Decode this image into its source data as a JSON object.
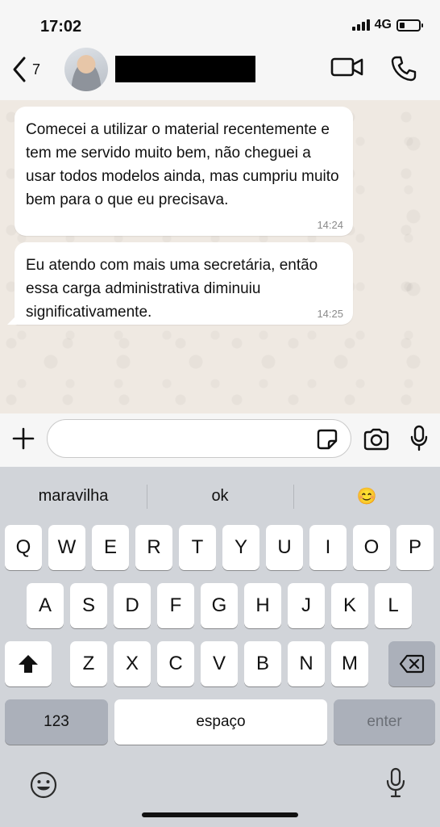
{
  "status_bar": {
    "time": "17:02",
    "network": "4G"
  },
  "header": {
    "back_count": "7"
  },
  "messages": [
    {
      "text": "Comecei a utilizar o material recentemente e tem me servido muito bem, não cheguei a usar todos modelos ainda, mas cumpriu muito bem para o que eu precisava.",
      "time": "14:24"
    },
    {
      "text": "Eu atendo com mais uma secretária, então essa carga administrativa diminuiu significativamente.",
      "time": "14:25"
    }
  ],
  "input": {
    "value": "",
    "placeholder": ""
  },
  "keyboard": {
    "suggestions": [
      "maravilha",
      "ok",
      "😊"
    ],
    "rows": [
      [
        "Q",
        "W",
        "E",
        "R",
        "T",
        "Y",
        "U",
        "I",
        "O",
        "P"
      ],
      [
        "A",
        "S",
        "D",
        "F",
        "G",
        "H",
        "J",
        "K",
        "L"
      ],
      [
        "Z",
        "X",
        "C",
        "V",
        "B",
        "N",
        "M"
      ]
    ],
    "numbers_label": "123",
    "space_label": "espaço",
    "enter_label": "enter"
  }
}
